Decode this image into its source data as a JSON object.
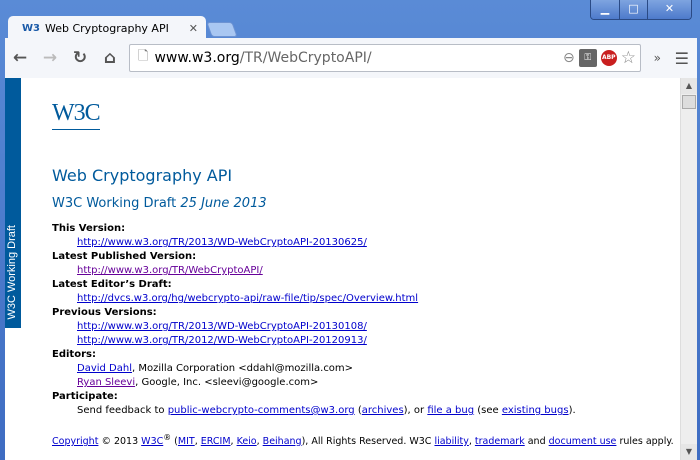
{
  "browser": {
    "tab_title": "Web Cryptography API",
    "tab_favicon": "W3",
    "url_host": "www.w3.org",
    "url_path": "/TR/WebCryptoAPI/",
    "abp_label": "ABP"
  },
  "sidebar_banner": "W3C Working Draft",
  "logo": "W3C",
  "title": "Web Cryptography API",
  "subtitle": "W3C Working Draft",
  "date": "25 June 2013",
  "sections": {
    "this_version": {
      "label": "This Version:",
      "link": "http://www.w3.org/TR/2013/WD-WebCryptoAPI-20130625/"
    },
    "latest": {
      "label": "Latest Published Version:",
      "link": "http://www.w3.org/TR/WebCryptoAPI/"
    },
    "editors_draft": {
      "label": "Latest Editor’s Draft:",
      "link": "http://dvcs.w3.org/hg/webcrypto-api/raw-file/tip/spec/Overview.html"
    },
    "previous": {
      "label": "Previous Versions:",
      "links": [
        "http://www.w3.org/TR/2013/WD-WebCryptoAPI-20130108/",
        "http://www.w3.org/TR/2012/WD-WebCryptoAPI-20120913/"
      ]
    },
    "editors": {
      "label": "Editors:",
      "people": [
        {
          "name": "David Dahl",
          "rest": ", Mozilla Corporation <ddahl@mozilla.com>"
        },
        {
          "name": "Ryan Sleevi",
          "rest": ", Google, Inc. <sleevi@google.com>"
        }
      ]
    },
    "participate": {
      "label": "Participate:",
      "t1": "Send feedback to ",
      "email": "public-webcrypto-comments@w3.org",
      "t2": " (",
      "archives": "archives",
      "t3": "), or ",
      "file_bug": "file a bug",
      "t4": " (see ",
      "existing": "existing bugs",
      "t5": ")."
    }
  },
  "copyright": {
    "copyright": "Copyright",
    "t1": " © 2013 ",
    "w3c": "W3C",
    "reg": "®",
    "t2": " (",
    "mit": "MIT",
    "ercim": "ERCIM",
    "keio": "Keio",
    "beihang": "Beihang",
    "t3": "), All Rights Reserved. W3C ",
    "liability": "liability",
    "trademark": "trademark",
    "t4": " and ",
    "doc_use": "document use",
    "t5": " rules apply.",
    "sep": ", "
  }
}
